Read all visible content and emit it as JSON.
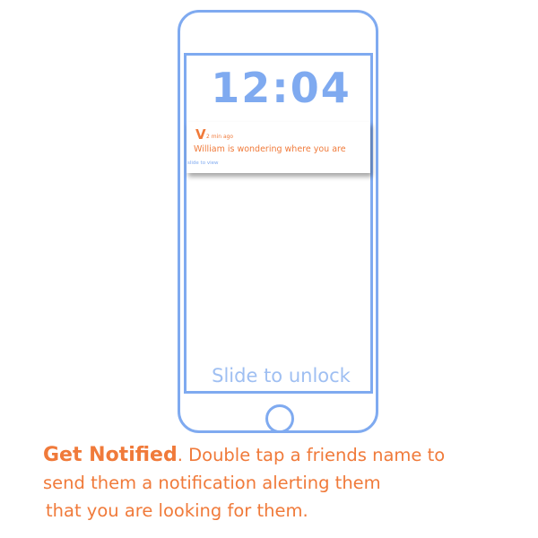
{
  "lockscreen": {
    "clock": "12:04",
    "slide_to_unlock": "Slide to unlock"
  },
  "notification": {
    "app_logo": "V",
    "time_ago": "2 min ago",
    "message": "William is wondering where you are",
    "action": "slide to view"
  },
  "caption": {
    "headline": "Get Notified",
    "headline_period": ".",
    "line1_rest": " Double tap a friends name to",
    "line2": "send them a notification alerting them",
    "line3": "that you are looking for them."
  },
  "colors": {
    "accent_orange": "#f07a3a",
    "phone_blue": "#7faaf0",
    "unlock_text_blue": "#9fbff2",
    "background": "#ffffff"
  },
  "icons": {
    "home_button": "home-button-circle",
    "app_logo": "v-logo-icon"
  }
}
